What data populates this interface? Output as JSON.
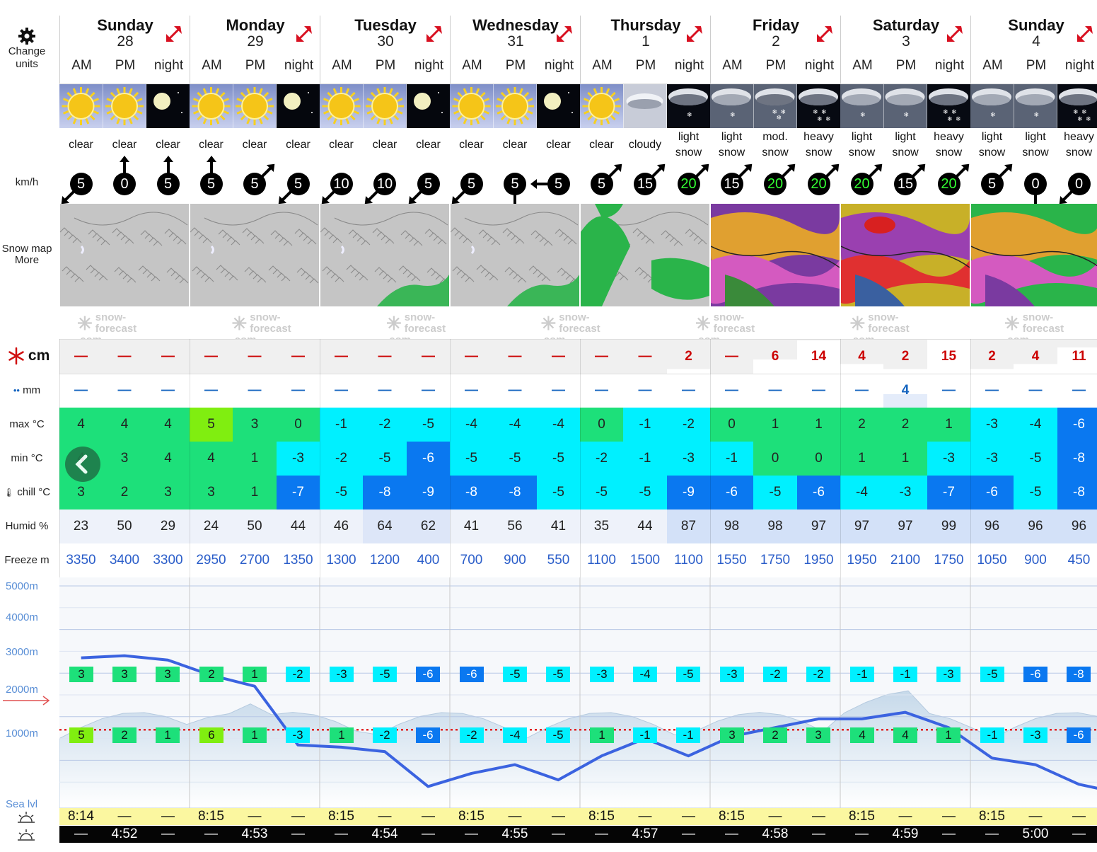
{
  "labels": {
    "change_units": [
      "Change",
      "units"
    ],
    "wind": "km/h",
    "snow_map": [
      "Snow map",
      "More"
    ],
    "snow_unit": "cm",
    "rain_unit": "mm",
    "max": "max °C",
    "min": "min °C",
    "chill": "chill °C",
    "humid": "Humid %",
    "freeze": "Freeze m",
    "altitudes": [
      "5000m",
      "4000m",
      "3000m",
      "2000m",
      "1000m",
      "Sea lvl"
    ]
  },
  "watermark": [
    "snow-forecast",
    ".com"
  ],
  "days": [
    {
      "name": "Sunday",
      "num": "28"
    },
    {
      "name": "Monday",
      "num": "29"
    },
    {
      "name": "Tuesday",
      "num": "30"
    },
    {
      "name": "Wednesday",
      "num": "31"
    },
    {
      "name": "Thursday",
      "num": "1"
    },
    {
      "name": "Friday",
      "num": "2"
    },
    {
      "name": "Saturday",
      "num": "3"
    },
    {
      "name": "Sunday",
      "num": "4"
    }
  ],
  "periods": [
    "AM",
    "PM",
    "night"
  ],
  "icons": [
    "sun-icon",
    "sun-icon",
    "moon-icon",
    "sun-icon",
    "sun-icon",
    "moon-icon",
    "sun-icon",
    "sun-icon",
    "moon-icon",
    "sun-icon",
    "sun-icon",
    "moon-icon",
    "sun-icon",
    "cloud-icon",
    "snow-cloud-icon",
    "snow-cloud-icon",
    "snow-cloud-icon",
    "snow-cloud-icon",
    "snow-cloud-icon",
    "snow-cloud-icon",
    "snow-cloud-icon",
    "snow-cloud-icon",
    "snow-cloud-icon",
    "snow-cloud-icon"
  ],
  "summary": [
    [
      "clear"
    ],
    [
      "clear"
    ],
    [
      "clear"
    ],
    [
      "clear"
    ],
    [
      "clear"
    ],
    [
      "clear"
    ],
    [
      "clear"
    ],
    [
      "clear"
    ],
    [
      "clear"
    ],
    [
      "clear"
    ],
    [
      "clear"
    ],
    [
      "clear"
    ],
    [
      "clear"
    ],
    [
      "cloudy"
    ],
    [
      "light",
      "snow"
    ],
    [
      "light",
      "snow"
    ],
    [
      "mod.",
      "snow"
    ],
    [
      "heavy",
      "snow"
    ],
    [
      "light",
      "snow"
    ],
    [
      "light",
      "snow"
    ],
    [
      "heavy",
      "snow"
    ],
    [
      "light",
      "snow"
    ],
    [
      "light",
      "snow"
    ],
    [
      "heavy",
      "snow"
    ]
  ],
  "wind": [
    "5",
    "0",
    "5",
    "5",
    "5",
    "5",
    "10",
    "10",
    "5",
    "5",
    "5",
    "5",
    "5",
    "15",
    "20",
    "15",
    "20",
    "20",
    "20",
    "15",
    "20",
    "5",
    "0",
    "0"
  ],
  "wind_dir": [
    225,
    0,
    0,
    0,
    45,
    225,
    225,
    225,
    225,
    225,
    180,
    270,
    45,
    45,
    45,
    45,
    45,
    45,
    45,
    45,
    45,
    45,
    180,
    225
  ],
  "wind_green": [
    false,
    false,
    false,
    false,
    false,
    false,
    false,
    false,
    false,
    false,
    false,
    false,
    false,
    false,
    true,
    false,
    true,
    true,
    true,
    false,
    true,
    false,
    false,
    false
  ],
  "snow_cm": [
    "—",
    "—",
    "—",
    "—",
    "—",
    "—",
    "—",
    "—",
    "—",
    "—",
    "—",
    "—",
    "—",
    "—",
    "2",
    "—",
    "6",
    "14",
    "4",
    "2",
    "15",
    "2",
    "4",
    "11"
  ],
  "rain_mm": [
    "—",
    "—",
    "—",
    "—",
    "—",
    "—",
    "—",
    "—",
    "—",
    "—",
    "—",
    "—",
    "—",
    "—",
    "—",
    "—",
    "—",
    "—",
    "—",
    "4",
    "—",
    "—",
    "—",
    "—"
  ],
  "max_c": [
    "4",
    "4",
    "4",
    "5",
    "3",
    "0",
    "-1",
    "-2",
    "-5",
    "-4",
    "-4",
    "-4",
    "0",
    "-1",
    "-2",
    "0",
    "1",
    "1",
    "2",
    "2",
    "1",
    "-3",
    "-4",
    "-6"
  ],
  "min_c": [
    "4",
    "3",
    "4",
    "4",
    "1",
    "-3",
    "-2",
    "-5",
    "-6",
    "-5",
    "-5",
    "-5",
    "-2",
    "-1",
    "-3",
    "-1",
    "0",
    "0",
    "1",
    "1",
    "-3",
    "-3",
    "-5",
    "-8"
  ],
  "chill_c": [
    "3",
    "2",
    "3",
    "3",
    "1",
    "-7",
    "-5",
    "-8",
    "-9",
    "-8",
    "-8",
    "-5",
    "-5",
    "-5",
    "-9",
    "-6",
    "-5",
    "-6",
    "-4",
    "-3",
    "-7",
    "-6",
    "-5",
    "-8"
  ],
  "humid": [
    "23",
    "50",
    "29",
    "24",
    "50",
    "44",
    "46",
    "64",
    "62",
    "41",
    "56",
    "41",
    "35",
    "44",
    "87",
    "98",
    "98",
    "97",
    "97",
    "97",
    "99",
    "96",
    "96",
    "96"
  ],
  "freeze_m": [
    "3350",
    "3400",
    "3300",
    "2950",
    "2700",
    "1350",
    "1300",
    "1200",
    "400",
    "700",
    "900",
    "550",
    "1100",
    "1500",
    "1100",
    "1550",
    "1750",
    "1950",
    "1950",
    "2100",
    "1750",
    "1050",
    "900",
    "450"
  ],
  "peak_temps": [
    "3",
    "3",
    "3",
    "2",
    "1",
    "-2",
    "-3",
    "-5",
    "-6",
    "-6",
    "-5",
    "-5",
    "-3",
    "-4",
    "-5",
    "-3",
    "-2",
    "-2",
    "-1",
    "-1",
    "-3",
    "-5",
    "-6",
    "-8"
  ],
  "base_temps": [
    "5",
    "2",
    "1",
    "6",
    "1",
    "-3",
    "1",
    "-2",
    "-6",
    "-2",
    "-4",
    "-5",
    "1",
    "-1",
    "-1",
    "3",
    "2",
    "3",
    "4",
    "4",
    "1",
    "-1",
    "-3",
    "-6"
  ],
  "sunrise": [
    "8:14",
    "—",
    "—",
    "8:15",
    "—",
    "—",
    "8:15",
    "—",
    "—",
    "8:15",
    "—",
    "—",
    "8:15",
    "—",
    "—",
    "8:15",
    "—",
    "—",
    "8:15",
    "—",
    "—",
    "8:15",
    "—",
    "—"
  ],
  "sunset": [
    "—",
    "4:52",
    "—",
    "—",
    "4:53",
    "—",
    "—",
    "4:54",
    "—",
    "—",
    "4:55",
    "—",
    "—",
    "4:57",
    "—",
    "—",
    "4:58",
    "—",
    "—",
    "4:59",
    "—",
    "—",
    "5:00",
    "—"
  ],
  "colors": {
    "temp_green": "#1de07a",
    "temp_lime": "#80ee10",
    "temp_cyan": "#00f0ff",
    "temp_blue": "#0a78f0",
    "humid_light": "#eef2fa",
    "humid_mid": "#dde6f8",
    "freeze_line": "#3b63e0",
    "snow_red": "#cc0000"
  }
}
